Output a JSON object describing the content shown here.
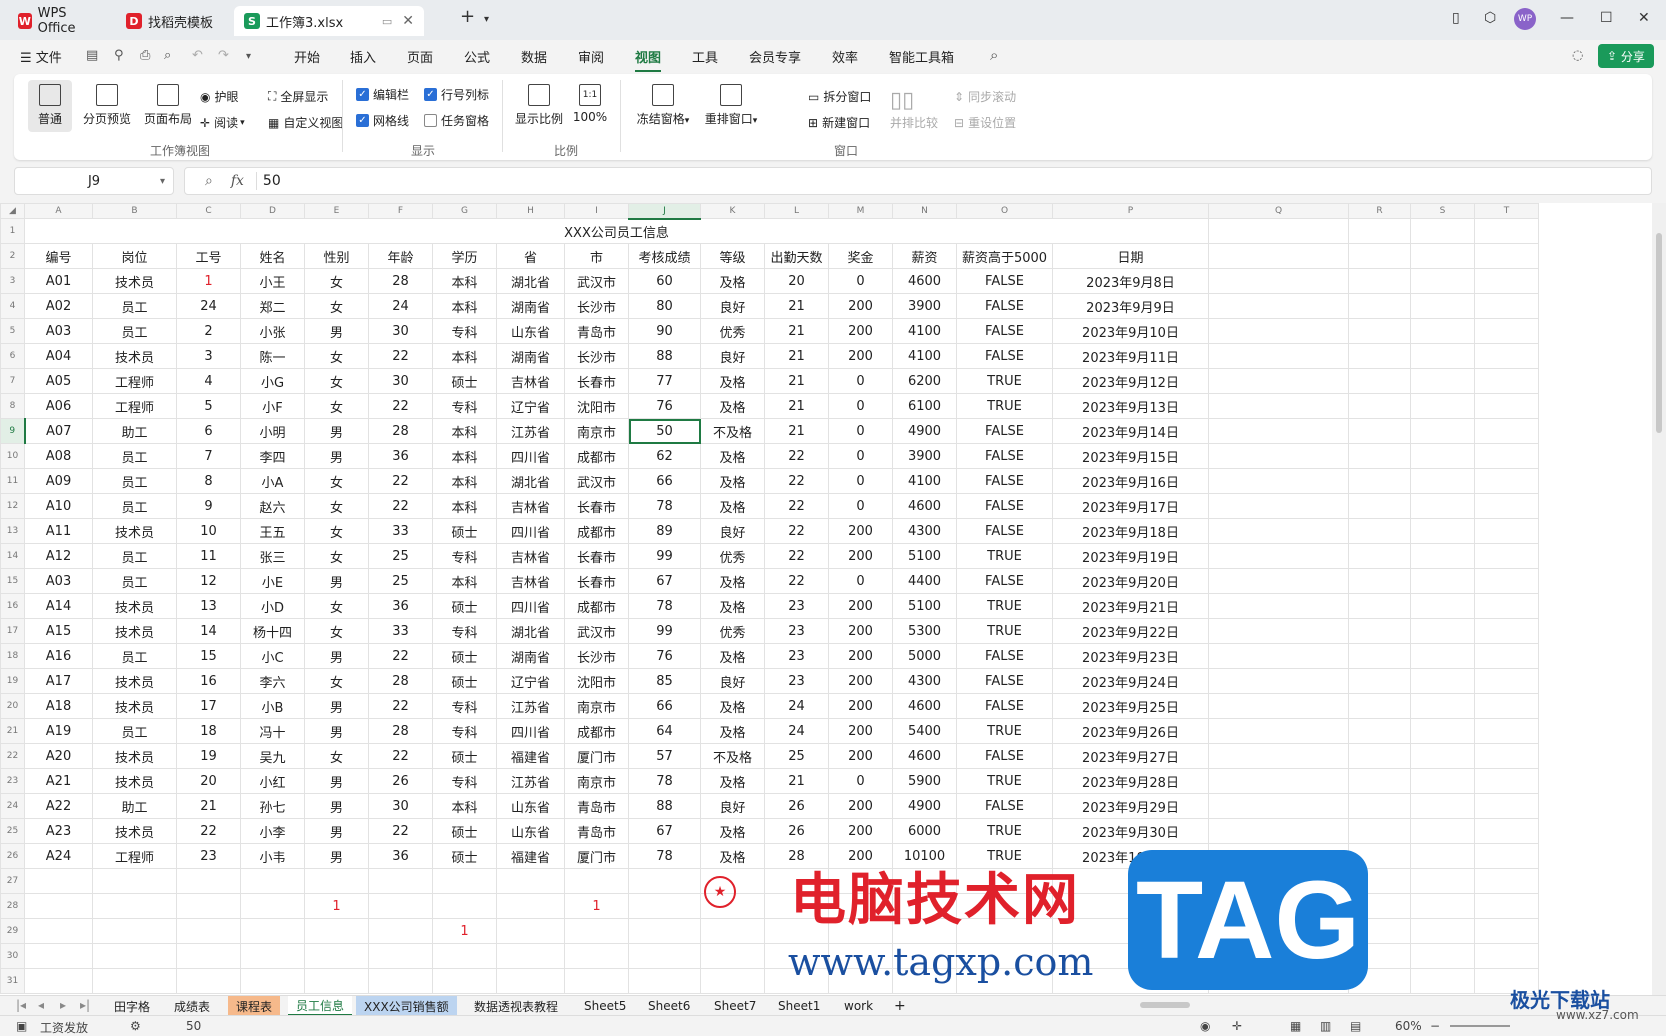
{
  "titlebar": {
    "tabs": [
      {
        "label": "WPS Office",
        "logo": "W",
        "color": "#e0212b"
      },
      {
        "label": "找稻壳模板",
        "logo": "D",
        "color": "#e0212b"
      },
      {
        "label": "工作簿3.xlsx",
        "logo": "S",
        "color": "#1a9a5a"
      }
    ],
    "new_tab": "+",
    "avatar": "WP"
  },
  "menu": {
    "file": "文件",
    "items": [
      "开始",
      "插入",
      "页面",
      "公式",
      "数据",
      "审阅",
      "视图",
      "工具",
      "会员专享",
      "效率",
      "智能工具箱"
    ],
    "active": "视图",
    "share": "分享"
  },
  "ribbon": {
    "view_big": [
      "普通",
      "分页预览",
      "页面布局"
    ],
    "view_small": [
      "护眼",
      "全屏显示",
      "阅读",
      "自定义视图"
    ],
    "group_workbook": "工作簿视图",
    "show": [
      {
        "label": "编辑栏",
        "checked": true
      },
      {
        "label": "行号列标",
        "checked": true
      },
      {
        "label": "网格线",
        "checked": true
      },
      {
        "label": "任务窗格",
        "checked": false
      }
    ],
    "group_show": "显示",
    "zoom": [
      "显示比例",
      "100%"
    ],
    "zoom_icon_text": "1:1",
    "group_zoom": "比例",
    "window_big": [
      "冻结窗格",
      "重排窗口"
    ],
    "window_small": [
      "拆分窗口",
      "新建窗口",
      "并排比较",
      "同步滚动",
      "重设位置"
    ],
    "group_window": "窗口"
  },
  "formula": {
    "cell_ref": "J9",
    "fx": "fx",
    "value": "50"
  },
  "grid": {
    "columns": [
      "A",
      "B",
      "C",
      "D",
      "E",
      "F",
      "G",
      "H",
      "I",
      "J",
      "K",
      "L",
      "M",
      "N",
      "O",
      "P",
      "Q",
      "R",
      "S",
      "T"
    ],
    "title": "XXX公司员工信息",
    "headers": [
      "编号",
      "岗位",
      "工号",
      "姓名",
      "性别",
      "年龄",
      "学历",
      "省",
      "市",
      "考核成绩",
      "等级",
      "出勤天数",
      "奖金",
      "薪资",
      "薪资高于5000",
      "日期"
    ],
    "rows": [
      [
        "A01",
        "技术员",
        "1",
        "小王",
        "女",
        "28",
        "本科",
        "湖北省",
        "武汉市",
        "60",
        "及格",
        "20",
        "0",
        "4600",
        "FALSE",
        "2023年9月8日"
      ],
      [
        "A02",
        "员工",
        "24",
        "郑二",
        "女",
        "24",
        "本科",
        "湖南省",
        "长沙市",
        "80",
        "良好",
        "21",
        "200",
        "3900",
        "FALSE",
        "2023年9月9日"
      ],
      [
        "A03",
        "员工",
        "2",
        "小张",
        "男",
        "30",
        "专科",
        "山东省",
        "青岛市",
        "90",
        "优秀",
        "21",
        "200",
        "4100",
        "FALSE",
        "2023年9月10日"
      ],
      [
        "A04",
        "技术员",
        "3",
        "陈一",
        "女",
        "22",
        "本科",
        "湖南省",
        "长沙市",
        "88",
        "良好",
        "21",
        "200",
        "4100",
        "FALSE",
        "2023年9月11日"
      ],
      [
        "A05",
        "工程师",
        "4",
        "小G",
        "女",
        "30",
        "硕士",
        "吉林省",
        "长春市",
        "77",
        "及格",
        "21",
        "0",
        "6200",
        "TRUE",
        "2023年9月12日"
      ],
      [
        "A06",
        "工程师",
        "5",
        "小F",
        "女",
        "22",
        "专科",
        "辽宁省",
        "沈阳市",
        "76",
        "及格",
        "21",
        "0",
        "6100",
        "TRUE",
        "2023年9月13日"
      ],
      [
        "A07",
        "助工",
        "6",
        "小明",
        "男",
        "28",
        "本科",
        "江苏省",
        "南京市",
        "50",
        "不及格",
        "21",
        "0",
        "4900",
        "FALSE",
        "2023年9月14日"
      ],
      [
        "A08",
        "员工",
        "7",
        "李四",
        "男",
        "36",
        "本科",
        "四川省",
        "成都市",
        "62",
        "及格",
        "22",
        "0",
        "3900",
        "FALSE",
        "2023年9月15日"
      ],
      [
        "A09",
        "员工",
        "8",
        "小A",
        "女",
        "22",
        "本科",
        "湖北省",
        "武汉市",
        "66",
        "及格",
        "22",
        "0",
        "4100",
        "FALSE",
        "2023年9月16日"
      ],
      [
        "A10",
        "员工",
        "9",
        "赵六",
        "女",
        "22",
        "本科",
        "吉林省",
        "长春市",
        "78",
        "及格",
        "22",
        "0",
        "4600",
        "FALSE",
        "2023年9月17日"
      ],
      [
        "A11",
        "技术员",
        "10",
        "王五",
        "女",
        "33",
        "硕士",
        "四川省",
        "成都市",
        "89",
        "良好",
        "22",
        "200",
        "4300",
        "FALSE",
        "2023年9月18日"
      ],
      [
        "A12",
        "员工",
        "11",
        "张三",
        "女",
        "25",
        "专科",
        "吉林省",
        "长春市",
        "99",
        "优秀",
        "22",
        "200",
        "5100",
        "TRUE",
        "2023年9月19日"
      ],
      [
        "A03",
        "员工",
        "12",
        "小E",
        "男",
        "25",
        "本科",
        "吉林省",
        "长春市",
        "67",
        "及格",
        "22",
        "0",
        "4400",
        "FALSE",
        "2023年9月20日"
      ],
      [
        "A14",
        "技术员",
        "13",
        "小D",
        "女",
        "36",
        "硕士",
        "四川省",
        "成都市",
        "78",
        "及格",
        "23",
        "200",
        "5100",
        "TRUE",
        "2023年9月21日"
      ],
      [
        "A15",
        "技术员",
        "14",
        "杨十四",
        "女",
        "33",
        "专科",
        "湖北省",
        "武汉市",
        "99",
        "优秀",
        "23",
        "200",
        "5300",
        "TRUE",
        "2023年9月22日"
      ],
      [
        "A16",
        "员工",
        "15",
        "小C",
        "男",
        "22",
        "硕士",
        "湖南省",
        "长沙市",
        "76",
        "及格",
        "23",
        "200",
        "5000",
        "FALSE",
        "2023年9月23日"
      ],
      [
        "A17",
        "技术员",
        "16",
        "李六",
        "女",
        "28",
        "硕士",
        "辽宁省",
        "沈阳市",
        "85",
        "良好",
        "23",
        "200",
        "4300",
        "FALSE",
        "2023年9月24日"
      ],
      [
        "A18",
        "技术员",
        "17",
        "小B",
        "男",
        "22",
        "专科",
        "江苏省",
        "南京市",
        "66",
        "及格",
        "24",
        "200",
        "4600",
        "FALSE",
        "2023年9月25日"
      ],
      [
        "A19",
        "员工",
        "18",
        "冯十",
        "男",
        "28",
        "专科",
        "四川省",
        "成都市",
        "64",
        "及格",
        "24",
        "200",
        "5400",
        "TRUE",
        "2023年9月26日"
      ],
      [
        "A20",
        "技术员",
        "19",
        "吴九",
        "女",
        "22",
        "硕士",
        "福建省",
        "厦门市",
        "57",
        "不及格",
        "25",
        "200",
        "4600",
        "FALSE",
        "2023年9月27日"
      ],
      [
        "A21",
        "技术员",
        "20",
        "小红",
        "男",
        "26",
        "专科",
        "江苏省",
        "南京市",
        "78",
        "及格",
        "21",
        "0",
        "5900",
        "TRUE",
        "2023年9月28日"
      ],
      [
        "A22",
        "助工",
        "21",
        "孙七",
        "男",
        "30",
        "本科",
        "山东省",
        "青岛市",
        "88",
        "良好",
        "26",
        "200",
        "4900",
        "FALSE",
        "2023年9月29日"
      ],
      [
        "A23",
        "技术员",
        "22",
        "小李",
        "男",
        "22",
        "硕士",
        "山东省",
        "青岛市",
        "67",
        "及格",
        "26",
        "200",
        "6000",
        "TRUE",
        "2023年9月30日"
      ],
      [
        "A24",
        "工程师",
        "23",
        "小韦",
        "男",
        "36",
        "硕士",
        "福建省",
        "厦门市",
        "78",
        "及格",
        "28",
        "200",
        "10100",
        "TRUE",
        "2023年10月1日"
      ]
    ],
    "extra": {
      "e28": "1",
      "i28": "1",
      "g29": "1"
    },
    "active_cell": "J9",
    "red_color": "#e0212b",
    "accent": "#1f7a43"
  },
  "sheets": {
    "tabs": [
      "田字格",
      "成绩表",
      "课程表",
      "员工信息",
      "XXX公司销售额",
      "数据透视表教程",
      "Sheet5",
      "Sheet6",
      "Sheet7",
      "Sheet1",
      "work"
    ],
    "active": "员工信息",
    "add": "+"
  },
  "status": {
    "left": "工资发放",
    "value": "50",
    "zoom": "60%"
  },
  "watermark": {
    "cn": "电脑技术网",
    "url": "www.tagxp.com",
    "tag": "TAG",
    "jg": "极光下载站",
    "jg_url": "www.xz7.com"
  }
}
